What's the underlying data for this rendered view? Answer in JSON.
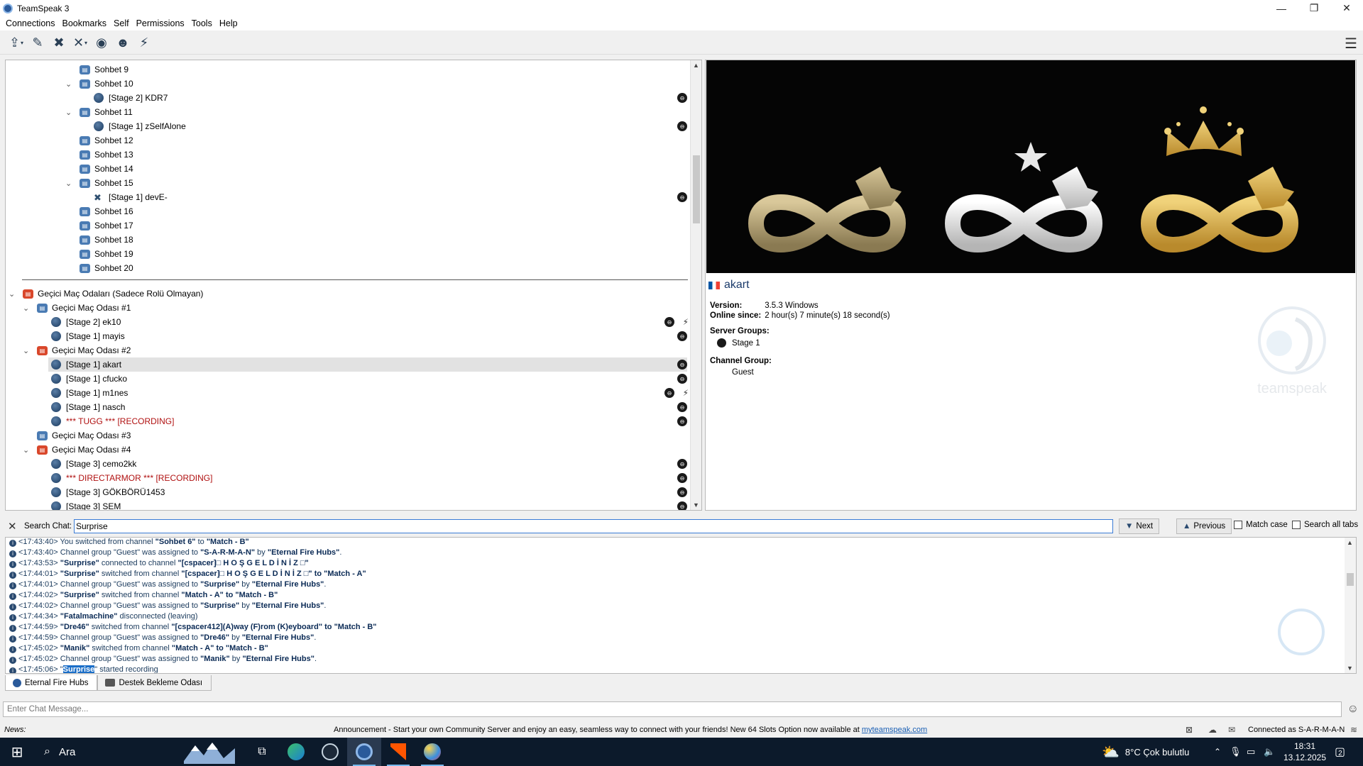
{
  "window": {
    "title": "TeamSpeak 3",
    "minimize": "—",
    "restore": "❐",
    "close": "✕"
  },
  "menu": [
    "Connections",
    "Bookmarks",
    "Self",
    "Permissions",
    "Tools",
    "Help"
  ],
  "tree": {
    "rows": [
      {
        "label": "Sohbet 9"
      },
      {
        "label": "Sohbet 10"
      },
      {
        "label": "[Stage 2] KDR7"
      },
      {
        "label": "Sohbet 11"
      },
      {
        "label": "[Stage 1] zSelfAlone"
      },
      {
        "label": "Sohbet 12"
      },
      {
        "label": "Sohbet 13"
      },
      {
        "label": "Sohbet 14"
      },
      {
        "label": "Sohbet 15"
      },
      {
        "label": "[Stage 1] devE-"
      },
      {
        "label": "Sohbet 16"
      },
      {
        "label": "Sohbet 17"
      },
      {
        "label": "Sohbet 18"
      },
      {
        "label": "Sohbet 19"
      },
      {
        "label": "Sohbet 20"
      },
      {
        "label": "Geçici Maç Odaları (Sadece Rolü Olmayan)"
      },
      {
        "label": "Geçici Maç Odası #1"
      },
      {
        "label": "[Stage 2] ek10"
      },
      {
        "label": "[Stage 1] mayis"
      },
      {
        "label": "Geçici Maç Odası #2"
      },
      {
        "label": "[Stage 1] akart"
      },
      {
        "label": "[Stage 1] cfucko"
      },
      {
        "label": "[Stage 1] m1nes"
      },
      {
        "label": "[Stage 1] nasch"
      },
      {
        "label": "*** TUGG *** [RECORDING]"
      },
      {
        "label": "Geçici Maç Odası #3"
      },
      {
        "label": "Geçici Maç Odası #4"
      },
      {
        "label": "[Stage 3] cemo2kk"
      },
      {
        "label": "*** DIRECTARMOR *** [RECORDING]"
      },
      {
        "label": "[Stage 3] GÖKBÖRÜ1453"
      },
      {
        "label": "[Stage 3] SEM"
      }
    ]
  },
  "client": {
    "nickname": "akart",
    "version_label": "Version:",
    "version": "3.5.3 Windows",
    "online_label": "Online since:",
    "online": "2 hour(s) 7 minute(s) 18 second(s)",
    "server_groups_label": "Server Groups:",
    "server_group": "Stage 1",
    "channel_group_label": "Channel Group:",
    "channel_group": "Guest",
    "logo_text": "teamspeak"
  },
  "search": {
    "label": "Search Chat:",
    "value": "Surprise",
    "next": "Next",
    "previous": "Previous",
    "match_case": "Match case",
    "search_all_tabs": "Search all tabs"
  },
  "chat": {
    "lines": [
      {
        "a": "<17:43:40> You switched from channel ",
        "b": "\"Sohbet 6\"",
        "c": " to ",
        "d": "\"Match - B\"",
        "e": ""
      },
      {
        "a": "<17:43:40> Channel group \"Guest\" was assigned to ",
        "b": "\"S-A-R-M-A-N\"",
        "c": " by ",
        "d": "\"Eternal Fire Hubs\"",
        "e": "."
      },
      {
        "a": "<17:43:53> ",
        "b": "\"Surprise\"",
        "c": " connected to channel ",
        "d": "\"[cspacer]□ H O Ş G E L D İ N İ Z □\"",
        "e": ""
      },
      {
        "a": "<17:44:01> ",
        "b": "\"Surprise\"",
        "c": " switched from channel ",
        "d": "\"[cspacer]□ H O Ş G E L D İ N İ Z □\"",
        "e": " to \"Match - A\""
      },
      {
        "a": "<17:44:01> Channel group \"Guest\" was assigned to ",
        "b": "\"Surprise\"",
        "c": " by ",
        "d": "\"Eternal Fire Hubs\"",
        "e": "."
      },
      {
        "a": "<17:44:02> ",
        "b": "\"Surprise\"",
        "c": " switched from channel ",
        "d": "\"Match - A\"",
        "e": " to \"Match - B\""
      },
      {
        "a": "<17:44:02> Channel group \"Guest\" was assigned to ",
        "b": "\"Surprise\"",
        "c": " by ",
        "d": "\"Eternal Fire Hubs\"",
        "e": "."
      },
      {
        "a": "<17:44:34> ",
        "b": "\"Fatalmachine\"",
        "c": " disconnected (leaving)",
        "d": "",
        "e": ""
      },
      {
        "a": "<17:44:59> ",
        "b": "\"Dre46\"",
        "c": " switched from channel ",
        "d": "\"[cspacer412](A)way (F)rom (K)eyboard\"",
        "e": " to \"Match - B\""
      },
      {
        "a": "<17:44:59> Channel group \"Guest\" was assigned to ",
        "b": "\"Dre46\"",
        "c": " by ",
        "d": "\"Eternal Fire Hubs\"",
        "e": "."
      },
      {
        "a": "<17:45:02> ",
        "b": "\"Manik\"",
        "c": " switched from channel ",
        "d": "\"Match - A\"",
        "e": " to \"Match - B\""
      },
      {
        "a": "<17:45:02> Channel group \"Guest\" was assigned to ",
        "b": "\"Manik\"",
        "c": " by ",
        "d": "\"Eternal Fire Hubs\"",
        "e": "."
      }
    ],
    "last": {
      "a": "<17:45:06> \"",
      "hl": "Surprise",
      "c": "\" started recording"
    }
  },
  "tabs": [
    "Eternal Fire Hubs",
    "Destek Bekleme Odası"
  ],
  "message": {
    "placeholder": "Enter Chat Message..."
  },
  "status": {
    "news": "News:",
    "announcement": "Announcement - Start your own Community Server and enjoy an easy, seamless way to connect with your friends! New 64 Slots Option now available at ",
    "link": "myteamspeak.com",
    "connected": "Connected as S-A-R-M-A-N"
  },
  "taskbar": {
    "search": "Ara",
    "weather": "8°C  Çok bulutlu",
    "time": "18:31",
    "date": "13.12.2025",
    "notifications": "2"
  }
}
